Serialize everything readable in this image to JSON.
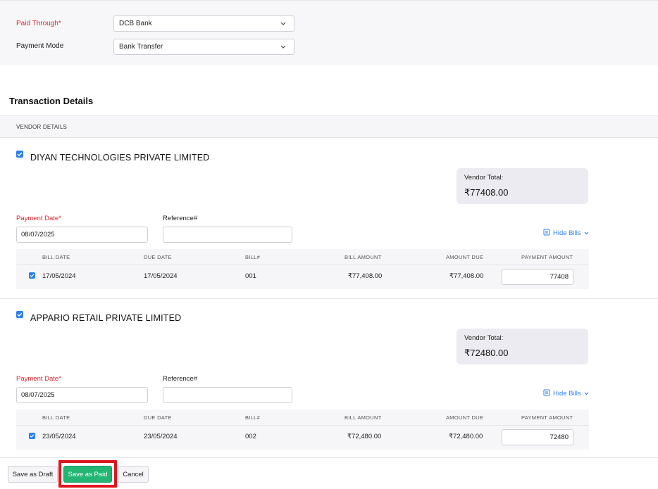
{
  "form": {
    "paid_through_label": "Paid Through*",
    "paid_through_value": "DCB Bank",
    "payment_mode_label": "Payment Mode",
    "payment_mode_value": "Bank Transfer"
  },
  "transaction": {
    "title": "Transaction Details",
    "vendor_header": "VENDOR DETAILS"
  },
  "columns": [
    "BILL DATE",
    "DUE DATE",
    "BILL#",
    "BILL AMOUNT",
    "AMOUNT DUE",
    "PAYMENT AMOUNT"
  ],
  "vendors": [
    {
      "name": "DIYAN TECHNOLOGIES PRIVATE LIMITED",
      "total_label": "Vendor Total:",
      "total_value": "₹77408.00",
      "payment_date_label": "Payment Date*",
      "payment_date_value": "08/07/2025",
      "reference_label": "Reference#",
      "reference_value": "",
      "hide_bills_label": "Hide Bills",
      "bill": {
        "bill_date": "17/05/2024",
        "due_date": "17/05/2024",
        "bill_no": "001",
        "bill_amount": "₹77,408.00",
        "amount_due": "₹77,408.00",
        "payment_amount": "77408"
      }
    },
    {
      "name": "APPARIO RETAIL PRIVATE LIMITED",
      "total_label": "Vendor Total:",
      "total_value": "₹72480.00",
      "payment_date_label": "Payment Date*",
      "payment_date_value": "08/07/2025",
      "reference_label": "Reference#",
      "reference_value": "",
      "hide_bills_label": "Hide Bills",
      "bill": {
        "bill_date": "23/05/2024",
        "due_date": "23/05/2024",
        "bill_no": "002",
        "bill_amount": "₹72,480.00",
        "amount_due": "₹72,480.00",
        "payment_amount": "72480"
      }
    }
  ],
  "footer": {
    "save_draft_label": "Save as Draft",
    "save_paid_label": "Save as Paid",
    "cancel_label": "Cancel"
  },
  "colors": {
    "accent_blue": "#2d7ff0",
    "primary_green": "#22b573",
    "required_red": "#d8272d",
    "highlight_red": "#e0151e"
  }
}
